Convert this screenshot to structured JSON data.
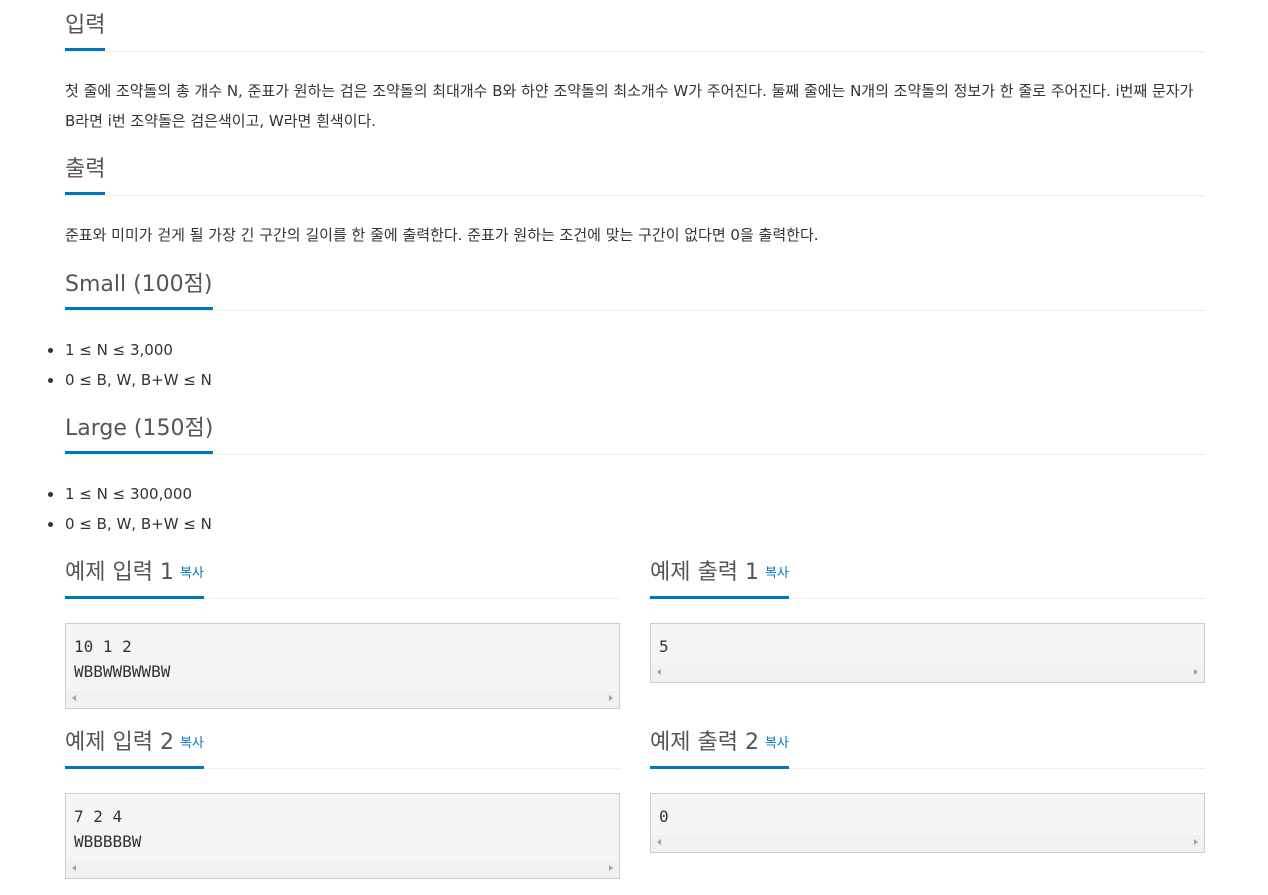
{
  "sections": {
    "input": {
      "title": "입력",
      "text": "첫 줄에 조약돌의 총 개수 N, 준표가 원하는 검은 조약돌의 최대개수 B와 하얀 조약돌의 최소개수 W가 주어진다. 둘째 줄에는 N개의 조약돌의 정보가 한 줄로 주어진다. i번째 문자가 B라면 i번 조약돌은 검은색이고, W라면 흰색이다."
    },
    "output": {
      "title": "출력",
      "text": "준표와 미미가 걷게 될 가장 긴 구간의 길이를 한 줄에 출력한다. 준표가 원하는 조건에 맞는 구간이 없다면 0을 출력한다."
    },
    "small": {
      "title": "Small (100점)",
      "items": [
        "1 ≤ N ≤ 3,000",
        "0 ≤ B, W, B+W ≤ N"
      ]
    },
    "large": {
      "title": "Large (150점)",
      "items": [
        "1 ≤ N ≤ 300,000",
        "0 ≤ B, W, B+W ≤ N"
      ]
    }
  },
  "examples": [
    {
      "input_title": "예제 입력 1",
      "input_copy": "복사",
      "input_lines": [
        "10 1 2",
        "WBBWWBWWBW"
      ],
      "output_title": "예제 출력 1",
      "output_copy": "복사",
      "output_lines": [
        "5"
      ]
    },
    {
      "input_title": "예제 입력 2",
      "input_copy": "복사",
      "input_lines": [
        "7 2 4",
        "WBBBBBW"
      ],
      "output_title": "예제 출력 2",
      "output_copy": "복사",
      "output_lines": [
        "0"
      ]
    }
  ],
  "colors": {
    "accent": "#0076c0",
    "text": "#333333",
    "pre_bg": "#f5f5f5",
    "pre_border": "#cccccc"
  },
  "icons": [
    "scroll-left-arrow-icon",
    "scroll-right-arrow-icon"
  ]
}
